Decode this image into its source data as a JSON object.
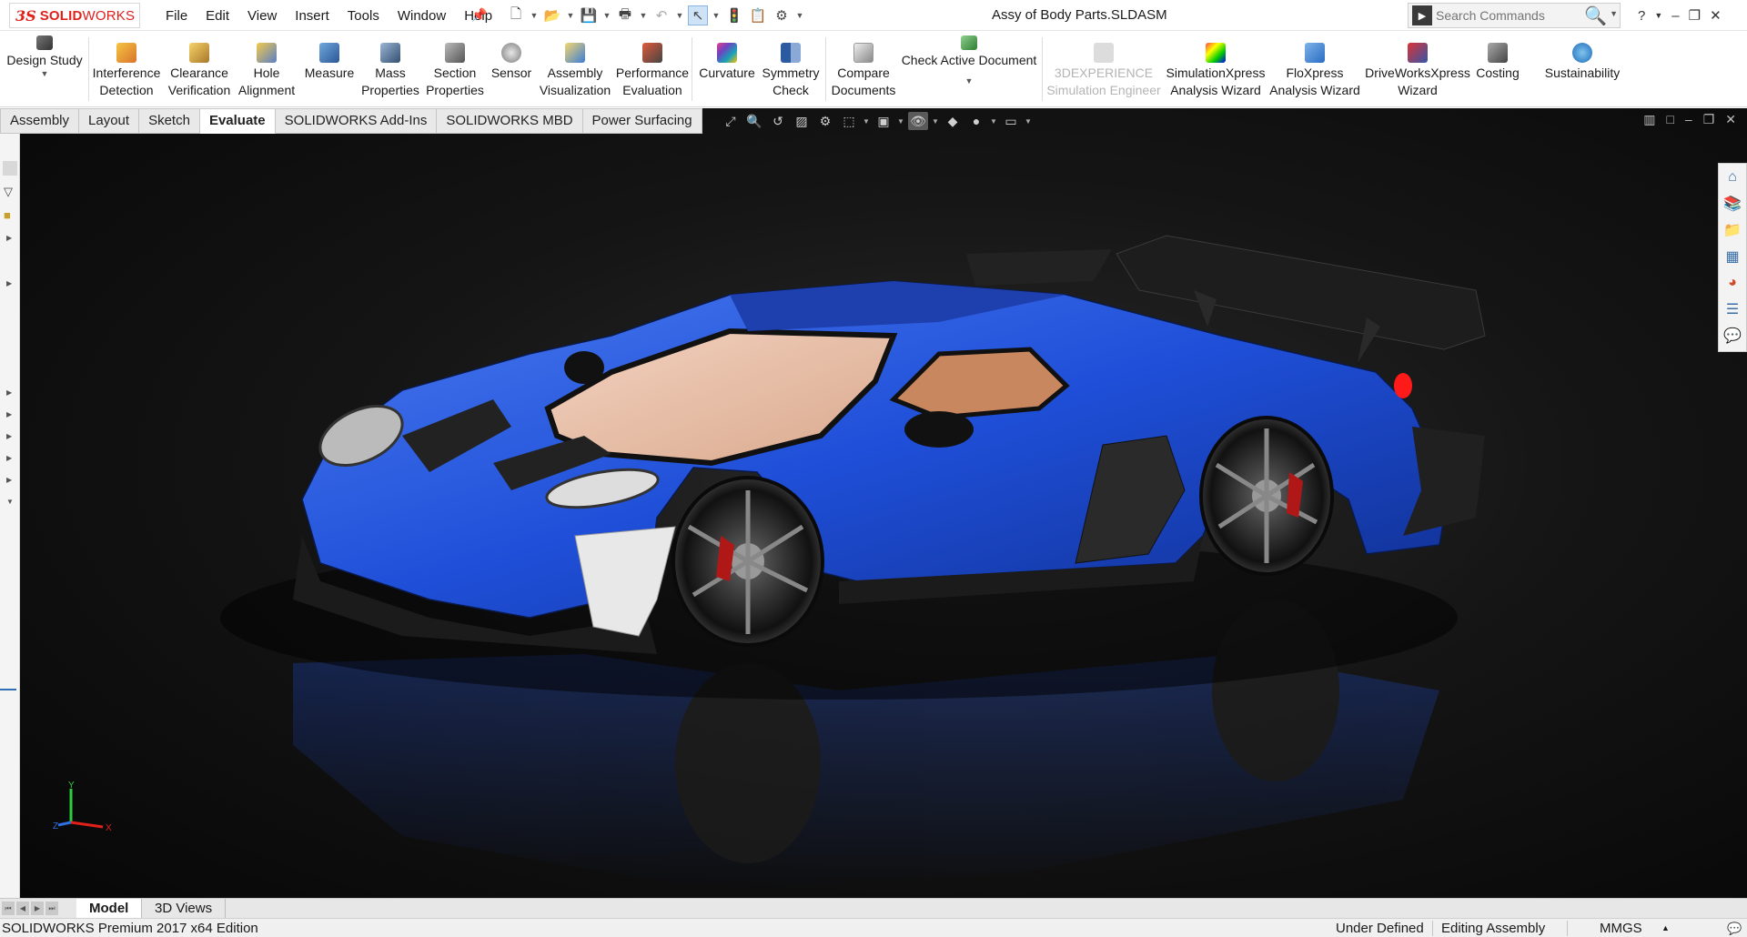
{
  "app": {
    "brand_ds": "3S",
    "brand_solid": "SOLID",
    "brand_works": "WORKS",
    "document_title": "Assy of Body Parts.SLDASM"
  },
  "menu": [
    "File",
    "Edit",
    "View",
    "Insert",
    "Tools",
    "Window",
    "Help"
  ],
  "search": {
    "placeholder": "Search Commands"
  },
  "commands": [
    {
      "label1": "Design Study",
      "label2": "",
      "caret": true
    },
    {
      "label1": "Interference",
      "label2": "Detection"
    },
    {
      "label1": "Clearance",
      "label2": "Verification"
    },
    {
      "label1": "Hole",
      "label2": "Alignment"
    },
    {
      "label1": "Measure",
      "label2": ""
    },
    {
      "label1": "Mass",
      "label2": "Properties"
    },
    {
      "label1": "Section",
      "label2": "Properties"
    },
    {
      "label1": "Sensor",
      "label2": ""
    },
    {
      "label1": "Assembly",
      "label2": "Visualization"
    },
    {
      "label1": "Performance",
      "label2": "Evaluation"
    },
    {
      "label1": "Curvature",
      "label2": ""
    },
    {
      "label1": "Symmetry",
      "label2": "Check"
    },
    {
      "label1": "Compare",
      "label2": "Documents"
    },
    {
      "label1": "Check Active Document",
      "label2": "",
      "caret": true
    },
    {
      "label1": "3DEXPERIENCE",
      "label2": "Simulation Engineer",
      "disabled": true
    },
    {
      "label1": "SimulationXpress",
      "label2": "Analysis Wizard"
    },
    {
      "label1": "FloXpress",
      "label2": "Analysis Wizard"
    },
    {
      "label1": "DriveWorksXpress",
      "label2": "Wizard"
    },
    {
      "label1": "Costing",
      "label2": ""
    },
    {
      "label1": "Sustainability",
      "label2": ""
    }
  ],
  "tabs": [
    "Assembly",
    "Layout",
    "Sketch",
    "Evaluate",
    "SOLIDWORKS Add-Ins",
    "SOLIDWORKS MBD",
    "Power Surfacing"
  ],
  "active_tab": "Evaluate",
  "bottom_tabs": [
    "Model",
    "3D Views"
  ],
  "triad": {
    "x": "X",
    "y": "Y",
    "z": "Z"
  },
  "status": {
    "edition": "SOLIDWORKS Premium 2017 x64 Edition",
    "definition": "Under Defined",
    "mode": "Editing Assembly",
    "units": "MMGS"
  },
  "colors": {
    "car_body": "#1f4fd8",
    "brand_red": "#e0201b",
    "viewport_bg": "#121212"
  }
}
